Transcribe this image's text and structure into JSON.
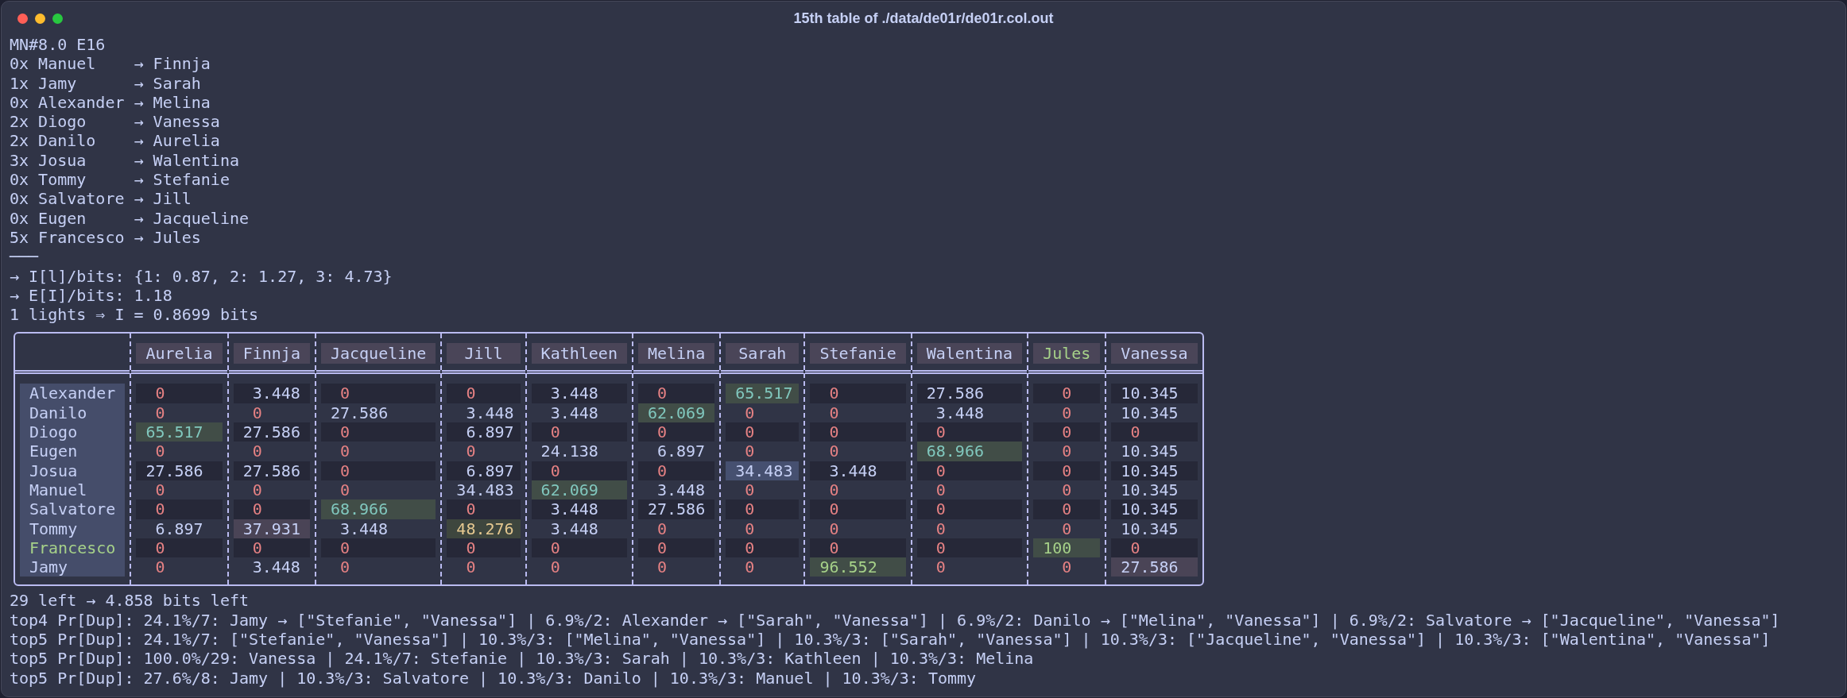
{
  "window": {
    "title": "15th table of ./data/de01r/de01r.col.out"
  },
  "header_lines": [
    "MN#8.0 E16",
    "0x Manuel    → Finnja",
    "1x Jamy      → Sarah",
    "0x Alexander → Melina",
    "2x Diogo     → Vanessa",
    "2x Danilo    → Aurelia",
    "3x Josua     → Walentina",
    "0x Tommy     → Stefanie",
    "0x Salvatore → Jill",
    "0x Eugen     → Jacqueline",
    "5x Francesco → Jules",
    "───",
    "→ I[l]/bits: {1: 0.87, 2: 1.27, 3: 4.73}",
    "→ E[I]/bits: 1.18",
    "1 lights ⇒ I = 0.8699 bits"
  ],
  "table": {
    "columns": [
      {
        "label": "Aurelia",
        "highlight": false
      },
      {
        "label": "Finnja",
        "highlight": false
      },
      {
        "label": "Jacqueline",
        "highlight": false
      },
      {
        "label": "Jill",
        "highlight": false
      },
      {
        "label": "Kathleen",
        "highlight": false
      },
      {
        "label": "Melina",
        "highlight": false
      },
      {
        "label": "Sarah",
        "highlight": false
      },
      {
        "label": "Stefanie",
        "highlight": false
      },
      {
        "label": "Walentina",
        "highlight": false
      },
      {
        "label": "Jules",
        "highlight": true
      },
      {
        "label": "Vanessa",
        "highlight": false
      }
    ],
    "rows": [
      {
        "label": "Alexander",
        "highlight": false,
        "cells": [
          {
            "value": "0",
            "kind": "zero"
          },
          {
            "value": "3.448",
            "kind": "plain"
          },
          {
            "value": "0",
            "kind": "zero"
          },
          {
            "value": "0",
            "kind": "zero"
          },
          {
            "value": "3.448",
            "kind": "plain"
          },
          {
            "value": "0",
            "kind": "zero"
          },
          {
            "value": "65.517",
            "kind": "green"
          },
          {
            "value": "0",
            "kind": "zero"
          },
          {
            "value": "27.586",
            "kind": "plain"
          },
          {
            "value": "0",
            "kind": "zero"
          },
          {
            "value": "10.345",
            "kind": "plain"
          }
        ]
      },
      {
        "label": "Danilo",
        "highlight": false,
        "cells": [
          {
            "value": "0",
            "kind": "zero"
          },
          {
            "value": "0",
            "kind": "zero"
          },
          {
            "value": "27.586",
            "kind": "plain"
          },
          {
            "value": "3.448",
            "kind": "plain"
          },
          {
            "value": "3.448",
            "kind": "plain"
          },
          {
            "value": "62.069",
            "kind": "green"
          },
          {
            "value": "0",
            "kind": "zero"
          },
          {
            "value": "0",
            "kind": "zero"
          },
          {
            "value": "3.448",
            "kind": "plain"
          },
          {
            "value": "0",
            "kind": "zero"
          },
          {
            "value": "10.345",
            "kind": "plain"
          }
        ]
      },
      {
        "label": "Diogo",
        "highlight": false,
        "cells": [
          {
            "value": "65.517",
            "kind": "green"
          },
          {
            "value": "27.586",
            "kind": "plain"
          },
          {
            "value": "0",
            "kind": "zero"
          },
          {
            "value": "6.897",
            "kind": "plain"
          },
          {
            "value": "0",
            "kind": "zero"
          },
          {
            "value": "0",
            "kind": "zero"
          },
          {
            "value": "0",
            "kind": "zero"
          },
          {
            "value": "0",
            "kind": "zero"
          },
          {
            "value": "0",
            "kind": "zero"
          },
          {
            "value": "0",
            "kind": "zero"
          },
          {
            "value": "0",
            "kind": "zero"
          }
        ]
      },
      {
        "label": "Eugen",
        "highlight": false,
        "cells": [
          {
            "value": "0",
            "kind": "zero"
          },
          {
            "value": "0",
            "kind": "zero"
          },
          {
            "value": "0",
            "kind": "zero"
          },
          {
            "value": "0",
            "kind": "zero"
          },
          {
            "value": "24.138",
            "kind": "plain"
          },
          {
            "value": "6.897",
            "kind": "plain"
          },
          {
            "value": "0",
            "kind": "zero"
          },
          {
            "value": "0",
            "kind": "zero"
          },
          {
            "value": "68.966",
            "kind": "green"
          },
          {
            "value": "0",
            "kind": "zero"
          },
          {
            "value": "10.345",
            "kind": "plain"
          }
        ]
      },
      {
        "label": "Josua",
        "highlight": false,
        "cells": [
          {
            "value": "27.586",
            "kind": "plain"
          },
          {
            "value": "27.586",
            "kind": "plain"
          },
          {
            "value": "0",
            "kind": "zero"
          },
          {
            "value": "6.897",
            "kind": "plain"
          },
          {
            "value": "0",
            "kind": "zero"
          },
          {
            "value": "0",
            "kind": "zero"
          },
          {
            "value": "34.483",
            "kind": "blue"
          },
          {
            "value": "3.448",
            "kind": "plain"
          },
          {
            "value": "0",
            "kind": "zero"
          },
          {
            "value": "0",
            "kind": "zero"
          },
          {
            "value": "10.345",
            "kind": "plain"
          }
        ]
      },
      {
        "label": "Manuel",
        "highlight": false,
        "cells": [
          {
            "value": "0",
            "kind": "zero"
          },
          {
            "value": "0",
            "kind": "zero"
          },
          {
            "value": "0",
            "kind": "zero"
          },
          {
            "value": "34.483",
            "kind": "plain"
          },
          {
            "value": "62.069",
            "kind": "green"
          },
          {
            "value": "3.448",
            "kind": "plain"
          },
          {
            "value": "0",
            "kind": "zero"
          },
          {
            "value": "0",
            "kind": "zero"
          },
          {
            "value": "0",
            "kind": "zero"
          },
          {
            "value": "0",
            "kind": "zero"
          },
          {
            "value": "10.345",
            "kind": "plain"
          }
        ]
      },
      {
        "label": "Salvatore",
        "highlight": false,
        "cells": [
          {
            "value": "0",
            "kind": "zero"
          },
          {
            "value": "0",
            "kind": "zero"
          },
          {
            "value": "68.966",
            "kind": "green"
          },
          {
            "value": "0",
            "kind": "zero"
          },
          {
            "value": "3.448",
            "kind": "plain"
          },
          {
            "value": "27.586",
            "kind": "plain"
          },
          {
            "value": "0",
            "kind": "zero"
          },
          {
            "value": "0",
            "kind": "zero"
          },
          {
            "value": "0",
            "kind": "zero"
          },
          {
            "value": "0",
            "kind": "zero"
          },
          {
            "value": "10.345",
            "kind": "plain"
          }
        ]
      },
      {
        "label": "Tommy",
        "highlight": false,
        "cells": [
          {
            "value": "6.897",
            "kind": "plain"
          },
          {
            "value": "37.931",
            "kind": "purple"
          },
          {
            "value": "3.448",
            "kind": "plain"
          },
          {
            "value": "48.276",
            "kind": "yellow"
          },
          {
            "value": "3.448",
            "kind": "plain"
          },
          {
            "value": "0",
            "kind": "zero"
          },
          {
            "value": "0",
            "kind": "zero"
          },
          {
            "value": "0",
            "kind": "zero"
          },
          {
            "value": "0",
            "kind": "zero"
          },
          {
            "value": "0",
            "kind": "zero"
          },
          {
            "value": "10.345",
            "kind": "plain"
          }
        ]
      },
      {
        "label": "Francesco",
        "highlight": true,
        "cells": [
          {
            "value": "0",
            "kind": "zero"
          },
          {
            "value": "0",
            "kind": "zero"
          },
          {
            "value": "0",
            "kind": "zero"
          },
          {
            "value": "0",
            "kind": "zero"
          },
          {
            "value": "0",
            "kind": "zero"
          },
          {
            "value": "0",
            "kind": "zero"
          },
          {
            "value": "0",
            "kind": "zero"
          },
          {
            "value": "0",
            "kind": "zero"
          },
          {
            "value": "0",
            "kind": "zero"
          },
          {
            "value": "100",
            "kind": "lime"
          },
          {
            "value": "0",
            "kind": "zero"
          }
        ]
      },
      {
        "label": "Jamy",
        "highlight": false,
        "cells": [
          {
            "value": "0",
            "kind": "zero"
          },
          {
            "value": "3.448",
            "kind": "plain"
          },
          {
            "value": "0",
            "kind": "zero"
          },
          {
            "value": "0",
            "kind": "zero"
          },
          {
            "value": "0",
            "kind": "zero"
          },
          {
            "value": "0",
            "kind": "zero"
          },
          {
            "value": "0",
            "kind": "zero"
          },
          {
            "value": "96.552",
            "kind": "lime"
          },
          {
            "value": "0",
            "kind": "zero"
          },
          {
            "value": "0",
            "kind": "zero"
          },
          {
            "value": "27.586",
            "kind": "purple"
          }
        ]
      }
    ]
  },
  "footer_lines": [
    "29 left → 4.858 bits left",
    "top4 Pr[Dup]: 24.1%/7: Jamy → [\"Stefanie\", \"Vanessa\"] | 6.9%/2: Alexander → [\"Sarah\", \"Vanessa\"] | 6.9%/2: Danilo → [\"Melina\", \"Vanessa\"] | 6.9%/2: Salvatore → [\"Jacqueline\", \"Vanessa\"]",
    "top5 Pr[Dup]: 24.1%/7: [\"Stefanie\", \"Vanessa\"] | 10.3%/3: [\"Melina\", \"Vanessa\"] | 10.3%/3: [\"Sarah\", \"Vanessa\"] | 10.3%/3: [\"Jacqueline\", \"Vanessa\"] | 10.3%/3: [\"Walentina\", \"Vanessa\"]",
    "top5 Pr[Dup]: 100.0%/29: Vanessa | 24.1%/7: Stefanie | 10.3%/3: Sarah | 10.3%/3: Kathleen | 10.3%/3: Melina",
    "top5 Pr[Dup]: 27.6%/8: Jamy | 10.3%/3: Salvatore | 10.3%/3: Danilo | 10.3%/3: Manuel | 10.3%/3: Tommy"
  ]
}
